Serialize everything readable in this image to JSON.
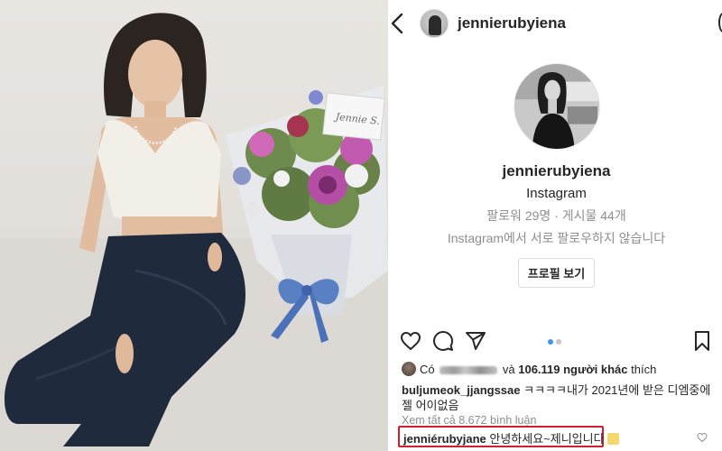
{
  "header": {
    "username": "jennierubyiena",
    "back_icon": "chevron-left-icon",
    "more_icon": "more-options-icon"
  },
  "photo": {
    "card_text": "Jennie S."
  },
  "profile": {
    "username": "jennierubyiena",
    "platform": "Instagram",
    "stats": "팔로워 29명 · 게시물 44개",
    "follow_status": "Instagram에서 서로 팔로우하지 않습니다",
    "view_profile_button": "프로필 보기"
  },
  "actions": {
    "icons": [
      "heart-icon",
      "comment-icon",
      "share-icon",
      "bookmark-icon"
    ],
    "carousel_dots": 2,
    "active_dot_color": "#3897f0",
    "inactive_dot_color": "#c7c7c7"
  },
  "likes": {
    "prefix": "Có",
    "middle": "và",
    "count": "106.119 người khác",
    "suffix": "thích"
  },
  "comment": {
    "username": "buljumeok_jjangssae",
    "text": "ㅋㅋㅋㅋ내가 2021년에 받은 디엠중에 젤 어이없음"
  },
  "view_all_comments": "Xem tất cả 8.672 bình luận",
  "reply": {
    "username": "jenniérubyjane",
    "text": "안녕하세요~제니입니다"
  },
  "colors": {
    "highlight_border": "#d0202f",
    "muted_text": "#8e8e8e",
    "primary_text": "#262626"
  }
}
